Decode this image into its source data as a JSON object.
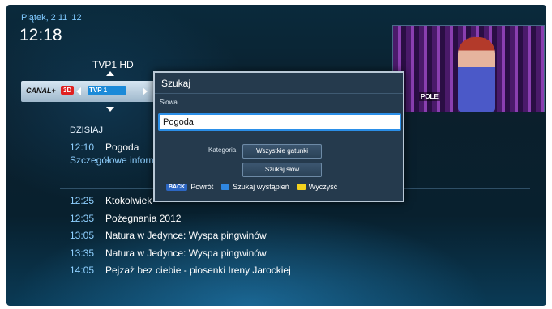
{
  "header": {
    "date": "Piątek, 2 11 '12",
    "time": "12:18"
  },
  "channel": {
    "current_name": "TVP1 HD",
    "left_logo": "CANAL+",
    "left_badge": "3D",
    "logo": "TVP 1",
    "preview_logo": "POLE"
  },
  "guide": {
    "day_label": "DZISIAJ",
    "selected": {
      "time": "12:10",
      "title": "Pogoda",
      "description": "Szczegółowe inform"
    },
    "items": [
      {
        "time": "12:25",
        "title": "Ktokolwiek"
      },
      {
        "time": "12:35",
        "title": "Pożegnania 2012"
      },
      {
        "time": "13:05",
        "title": "Natura w Jedynce: Wyspa pingwinów"
      },
      {
        "time": "13:35",
        "title": "Natura w Jedynce: Wyspa pingwinów"
      },
      {
        "time": "14:05",
        "title": "Pejzaż bez ciebie - piosenki Ireny Jarockiej"
      }
    ]
  },
  "search_dialog": {
    "title": "Szukaj",
    "words_label": "Słowa",
    "input_value": "Pogoda",
    "category_label": "Kategoria",
    "category_button": "Wszystkie gatunki",
    "search_button": "Szukaj słów",
    "footer": {
      "back_key": "BACK",
      "back_label": "Powrót",
      "blue_label": "Szukaj wystąpień",
      "yellow_label": "Wyczyść"
    }
  },
  "colors": {
    "accent_blue": "#2f86e0",
    "accent_yellow": "#f4d21e",
    "time_text": "#8fd0ff"
  }
}
